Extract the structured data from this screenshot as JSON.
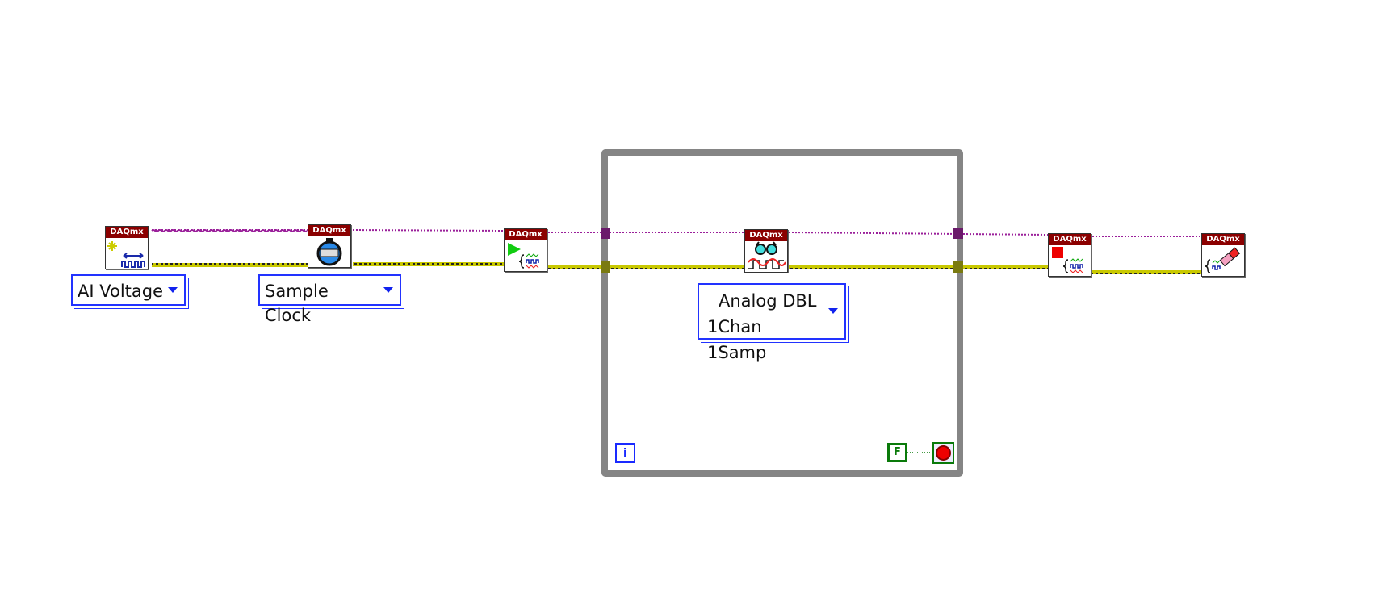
{
  "nodes": [
    {
      "id": "create-channel",
      "header": "DAQmx",
      "icon": "create-channel-icon"
    },
    {
      "id": "timing",
      "header": "DAQmx",
      "icon": "sample-clock-icon"
    },
    {
      "id": "start-task",
      "header": "DAQmx",
      "icon": "start-task-icon"
    },
    {
      "id": "read",
      "header": "DAQmx",
      "icon": "read-glasses-icon"
    },
    {
      "id": "stop-task",
      "header": "DAQmx",
      "icon": "stop-task-icon"
    },
    {
      "id": "clear-task",
      "header": "DAQmx",
      "icon": "clear-task-eraser-icon"
    }
  ],
  "selectors": {
    "channel_type": "AI Voltage",
    "timing_type": "Sample Clock",
    "read_type_line1": "Analog DBL",
    "read_type_line2": "1Chan 1Samp"
  },
  "loop": {
    "iteration_label": "i",
    "stop_constant": "F"
  },
  "colors": {
    "task_wire": "#9a1f9a",
    "error_wire": "#c8c800",
    "loop_border": "#858585",
    "daqmx_header": "#8b0000",
    "enum_border": "#2233ff",
    "bool": "#0a7a0a"
  }
}
